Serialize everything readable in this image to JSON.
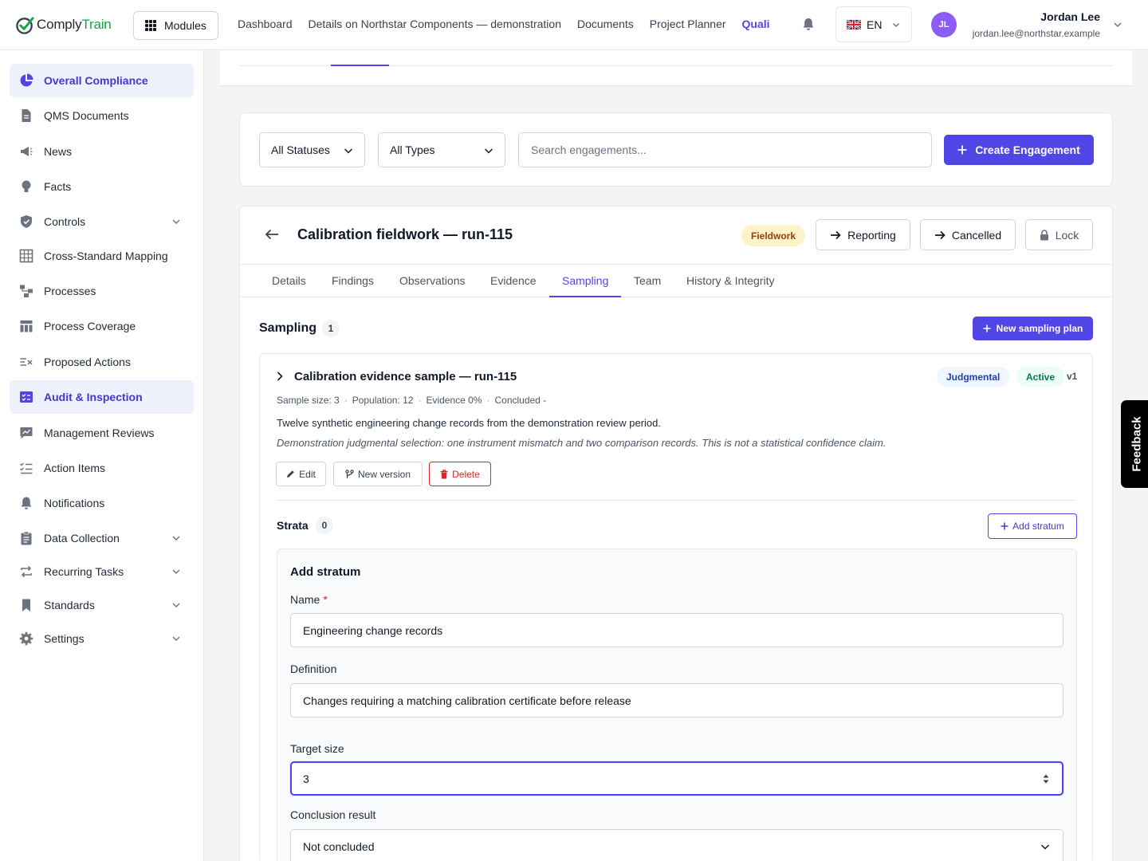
{
  "app": {
    "logo_text_1": "Comply",
    "logo_text_2": "Train",
    "brand_color": "#4f46e5"
  },
  "topbar": {
    "modules_label": "Modules",
    "nav": [
      "Dashboard",
      "Details on Northstar Components — demonstration",
      "Documents",
      "Project Planner",
      "Quali"
    ],
    "active_nav": "Quali",
    "language": "EN",
    "user_initials": "JL",
    "user_name": "Jordan Lee",
    "user_email": "jordan.lee@northstar.example"
  },
  "sidebar": {
    "items": [
      {
        "label": "Overall Compliance",
        "icon": "pie-chart-icon"
      },
      {
        "label": "QMS Documents",
        "icon": "document-icon"
      },
      {
        "label": "News",
        "icon": "megaphone-icon"
      },
      {
        "label": "Facts",
        "icon": "lightbulb-icon"
      },
      {
        "label": "Controls",
        "icon": "shield-icon"
      },
      {
        "label": "Cross-Standard Mapping",
        "icon": "table-icon"
      },
      {
        "label": "Processes",
        "icon": "process-icon"
      },
      {
        "label": "Process Coverage",
        "icon": "coverage-icon"
      },
      {
        "label": "Proposed Actions",
        "icon": "list-x-icon"
      },
      {
        "label": "Audit & Inspection",
        "icon": "audit-icon"
      },
      {
        "label": "Management Reviews",
        "icon": "chat-chart-icon"
      },
      {
        "label": "Action Items",
        "icon": "checklist-icon"
      },
      {
        "label": "Notifications",
        "icon": "bell-icon"
      },
      {
        "label": "Data Collection",
        "icon": "clipboard-icon"
      },
      {
        "label": "Recurring Tasks",
        "icon": "repeat-icon"
      },
      {
        "label": "Standards",
        "icon": "bookmark-icon"
      },
      {
        "label": "Settings",
        "icon": "gear-icon"
      }
    ]
  },
  "filters": {
    "status_value": "All Statuses",
    "type_value": "All Types",
    "search_placeholder": "Search engagements...",
    "create_label": "Create Engagement"
  },
  "engagement": {
    "title": "Calibration fieldwork — run-115",
    "status": "Fieldwork",
    "transition_1": "Reporting",
    "transition_2": "Cancelled",
    "lock_label": "Lock",
    "tabs": [
      "Details",
      "Findings",
      "Observations",
      "Evidence",
      "Sampling",
      "Team",
      "History & Integrity"
    ],
    "active_tab": "Sampling"
  },
  "sampling": {
    "title": "Sampling",
    "count": "1",
    "new_plan_label": "New sampling plan",
    "plan": {
      "title": "Calibration evidence sample — run-115",
      "method": "Judgmental",
      "state": "Active",
      "version": "v1",
      "meta": [
        "Sample size: 3",
        "Population: 12",
        "Evidence 0%",
        "Concluded -"
      ],
      "description": "Twelve synthetic engineering change records from the demonstration review period.",
      "rationale": "Demonstration judgmental selection: one instrument mismatch and two comparison records. This is not a statistical confidence claim.",
      "edit_label": "Edit",
      "version_label": "New version",
      "delete_label": "Delete"
    },
    "strata": {
      "title": "Strata",
      "count": "0",
      "add_label": "Add stratum"
    },
    "form": {
      "heading": "Add stratum",
      "name_label": "Name",
      "name_required": "*",
      "name_value": "Engineering change records",
      "definition_label": "Definition",
      "definition_value": "Changes requiring a matching calibration certificate before release",
      "target_label": "Target size",
      "target_value": "3",
      "conclusion_label": "Conclusion result",
      "conclusion_value": "Not concluded"
    }
  },
  "feedback_label": "Feedback"
}
